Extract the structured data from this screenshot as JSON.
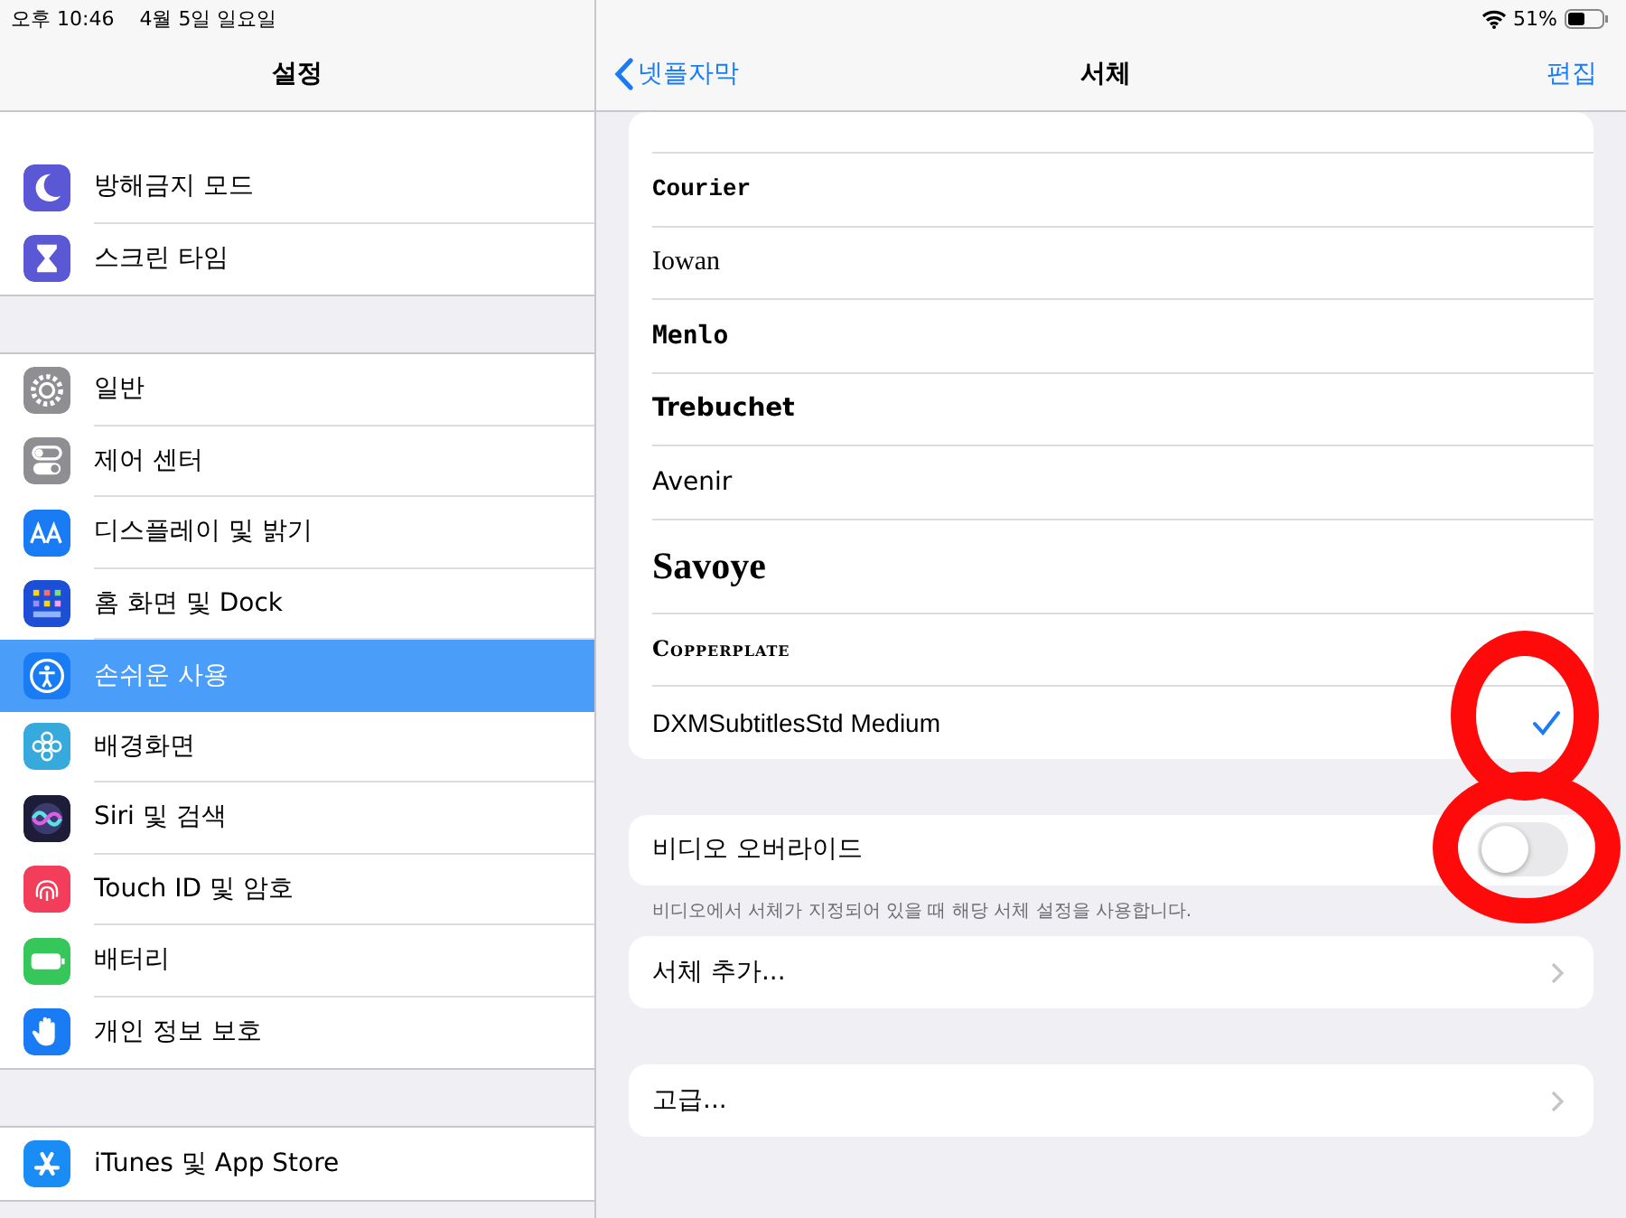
{
  "status_bar": {
    "time": "오후 10:46",
    "date": "4월 5일 일요일",
    "battery": "51%"
  },
  "sidebar": {
    "title": "설정",
    "groups": [
      [
        {
          "label": "방해금지 모드",
          "selected": false
        },
        {
          "label": "스크린 타임",
          "selected": false
        }
      ],
      [
        {
          "label": "일반",
          "selected": false
        },
        {
          "label": "제어 센터",
          "selected": false
        },
        {
          "label": "디스플레이 및 밝기",
          "selected": false
        },
        {
          "label": "홈 화면 및 Dock",
          "selected": false
        },
        {
          "label": "손쉬운 사용",
          "selected": true
        },
        {
          "label": "배경화면",
          "selected": false
        },
        {
          "label": "Siri 및 검색",
          "selected": false
        },
        {
          "label": "Touch ID 및 암호",
          "selected": false
        },
        {
          "label": "배터리",
          "selected": false
        },
        {
          "label": "개인 정보 보호",
          "selected": false
        }
      ],
      [
        {
          "label": "iTunes 및 App Store",
          "selected": false
        }
      ]
    ]
  },
  "detail": {
    "back": "넷플자막",
    "title": "서체",
    "edit": "편집",
    "fonts": [
      {
        "name": "Courier",
        "selected": false
      },
      {
        "name": "Iowan",
        "selected": false
      },
      {
        "name": "Menlo",
        "selected": false
      },
      {
        "name": "Trebuchet",
        "selected": false
      },
      {
        "name": "Avenir",
        "selected": false
      },
      {
        "name": "Savoye",
        "selected": false
      },
      {
        "name": "Copperplate",
        "selected": false
      },
      {
        "name": "DXMSubtitlesStd Medium",
        "selected": true
      }
    ],
    "override": {
      "label": "비디오 오버라이드",
      "on": false,
      "footnote": "비디오에서 서체가 지정되어 있을 때 해당 서체 설정을 사용합니다."
    },
    "links": [
      "서체 추가...",
      "고급..."
    ]
  }
}
